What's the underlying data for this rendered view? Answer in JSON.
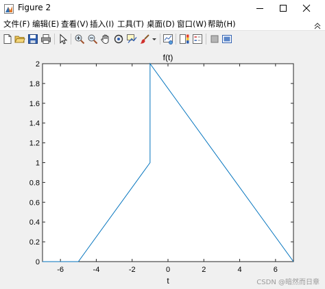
{
  "window": {
    "title": "Figure 2",
    "controls": [
      "minimize",
      "maximize",
      "close"
    ]
  },
  "menu": {
    "items": [
      {
        "label": "文件(F)"
      },
      {
        "label": "编辑(E)"
      },
      {
        "label": "查看(V)"
      },
      {
        "label": "插入(I)"
      },
      {
        "label": "工具(T)"
      },
      {
        "label": "桌面(D)"
      },
      {
        "label": "窗口(W)"
      },
      {
        "label": "帮助(H)"
      }
    ],
    "right_icon": "chevron-double-up-icon"
  },
  "toolbar": {
    "icons": [
      "new-figure-icon",
      "open-folder-icon",
      "save-icon",
      "print-icon",
      "pointer-icon",
      "zoom-in-icon",
      "zoom-out-icon",
      "pan-hand-icon",
      "rotate-3d-icon",
      "data-cursor-icon",
      "brush-icon",
      "dropdown-arrow-icon",
      "link-plot-icon",
      "colorbar-icon",
      "legend-icon",
      "hide-plot-tools-icon",
      "show-plot-tools-icon"
    ]
  },
  "watermark": "CSDN @暗然而日章",
  "chart_data": {
    "type": "line",
    "title": "f(t)",
    "xlabel": "t",
    "ylabel": "",
    "xlim": [
      -7,
      7
    ],
    "ylim": [
      0,
      2
    ],
    "xticks": [
      -6,
      -4,
      -2,
      0,
      2,
      4,
      6
    ],
    "yticks": [
      0,
      0.2,
      0.4,
      0.6,
      0.8,
      1,
      1.2,
      1.4,
      1.6,
      1.8,
      2
    ],
    "ytick_labels": [
      "0",
      "0.2",
      "0.4",
      "0.6",
      "0.8",
      "1",
      "1.2",
      "1.4",
      "1.6",
      "1.8",
      "2"
    ],
    "grid": false,
    "series": [
      {
        "color": "#0072bd",
        "x": [
          -7,
          -5,
          -1,
          -1,
          7
        ],
        "y": [
          0,
          0,
          1,
          2,
          0
        ]
      }
    ]
  }
}
